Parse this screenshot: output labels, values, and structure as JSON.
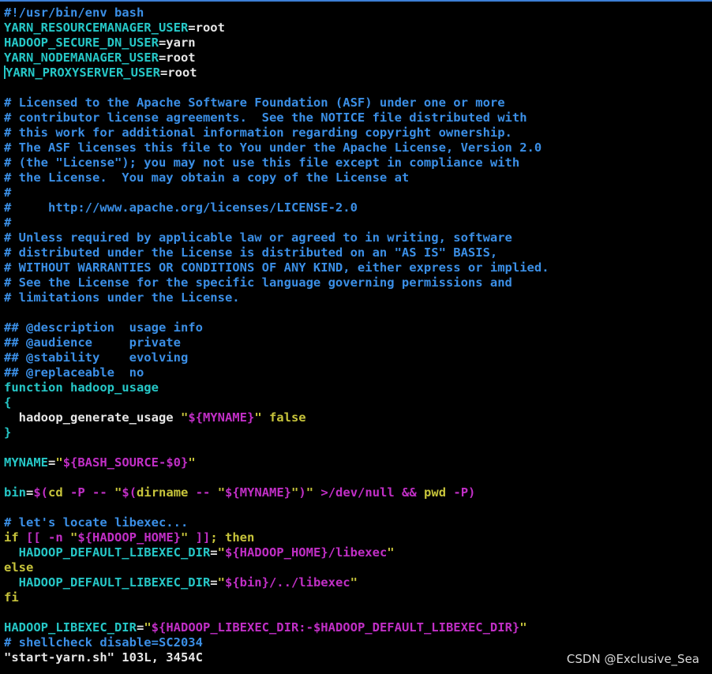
{
  "editor": {
    "file_name": "start-yarn.sh",
    "status_line": "\"start-yarn.sh\" 103L, 3454C",
    "lines": [
      [
        {
          "t": "#!/usr/bin/env bash",
          "c": "comment"
        }
      ],
      [
        {
          "t": "YARN_RESOURCEMANAGER_USER",
          "c": "cyan"
        },
        {
          "t": "=root",
          "c": "plain"
        }
      ],
      [
        {
          "t": "HADOOP_SECURE_DN_USER",
          "c": "cyan"
        },
        {
          "t": "=yarn",
          "c": "plain"
        }
      ],
      [
        {
          "t": "YARN_NODEMANAGER_USER",
          "c": "cyan"
        },
        {
          "t": "=root",
          "c": "plain"
        }
      ],
      [
        {
          "t": "",
          "c": "cursor"
        },
        {
          "t": "YARN_PROXYSERVER_USER",
          "c": "cyan"
        },
        {
          "t": "=root",
          "c": "plain"
        }
      ],
      [],
      [
        {
          "t": "# Licensed to the Apache Software Foundation (ASF) under one or more",
          "c": "comment"
        }
      ],
      [
        {
          "t": "# contributor license agreements.  See the NOTICE file distributed with",
          "c": "comment"
        }
      ],
      [
        {
          "t": "# this work for additional information regarding copyright ownership.",
          "c": "comment"
        }
      ],
      [
        {
          "t": "# The ASF licenses this file to You under the Apache License, Version 2.0",
          "c": "comment"
        }
      ],
      [
        {
          "t": "# (the \"License\"); you may not use this file except in compliance with",
          "c": "comment"
        }
      ],
      [
        {
          "t": "# the License.  You may obtain a copy of the License at",
          "c": "comment"
        }
      ],
      [
        {
          "t": "#",
          "c": "comment"
        }
      ],
      [
        {
          "t": "#     http://www.apache.org/licenses/LICENSE-2.0",
          "c": "comment"
        }
      ],
      [
        {
          "t": "#",
          "c": "comment"
        }
      ],
      [
        {
          "t": "# Unless required by applicable law or agreed to in writing, software",
          "c": "comment"
        }
      ],
      [
        {
          "t": "# distributed under the License is distributed on an \"AS IS\" BASIS,",
          "c": "comment"
        }
      ],
      [
        {
          "t": "# WITHOUT WARRANTIES OR CONDITIONS OF ANY KIND, either express or implied.",
          "c": "comment"
        }
      ],
      [
        {
          "t": "# See the License for the specific language governing permissions and",
          "c": "comment"
        }
      ],
      [
        {
          "t": "# limitations under the License.",
          "c": "comment"
        }
      ],
      [],
      [
        {
          "t": "## @description  usage info",
          "c": "comment"
        }
      ],
      [
        {
          "t": "## @audience     private",
          "c": "comment"
        }
      ],
      [
        {
          "t": "## @stability    evolving",
          "c": "comment"
        }
      ],
      [
        {
          "t": "## @replaceable  no",
          "c": "comment"
        }
      ],
      [
        {
          "t": "function hadoop_usage",
          "c": "cyan"
        }
      ],
      [
        {
          "t": "{",
          "c": "cyan"
        }
      ],
      [
        {
          "t": "  hadoop_generate_usage ",
          "c": "plain"
        },
        {
          "t": "\"",
          "c": "yellow"
        },
        {
          "t": "${MYNAME}",
          "c": "magenta"
        },
        {
          "t": "\" false",
          "c": "yellow"
        }
      ],
      [
        {
          "t": "}",
          "c": "cyan"
        }
      ],
      [],
      [
        {
          "t": "MYNAME",
          "c": "cyan"
        },
        {
          "t": "=",
          "c": "plain"
        },
        {
          "t": "\"",
          "c": "yellow"
        },
        {
          "t": "${BASH_SOURCE-$0}",
          "c": "magenta"
        },
        {
          "t": "\"",
          "c": "yellow"
        }
      ],
      [],
      [
        {
          "t": "bin",
          "c": "cyan"
        },
        {
          "t": "=",
          "c": "plain"
        },
        {
          "t": "$(",
          "c": "magenta"
        },
        {
          "t": "cd ",
          "c": "yellow"
        },
        {
          "t": "-P -- ",
          "c": "magenta"
        },
        {
          "t": "\"",
          "c": "yellow"
        },
        {
          "t": "$(",
          "c": "magenta"
        },
        {
          "t": "dirname ",
          "c": "yellow"
        },
        {
          "t": "-- ",
          "c": "magenta"
        },
        {
          "t": "\"",
          "c": "yellow"
        },
        {
          "t": "${MYNAME}",
          "c": "magenta"
        },
        {
          "t": "\"",
          "c": "yellow"
        },
        {
          "t": ")",
          "c": "magenta"
        },
        {
          "t": "\" ",
          "c": "yellow"
        },
        {
          "t": ">/dev/null && ",
          "c": "magenta"
        },
        {
          "t": "pwd ",
          "c": "yellow"
        },
        {
          "t": "-P)",
          "c": "magenta"
        }
      ],
      [],
      [
        {
          "t": "# let's locate libexec...",
          "c": "comment"
        }
      ],
      [
        {
          "t": "if ",
          "c": "yellow"
        },
        {
          "t": "[[ -n ",
          "c": "magenta"
        },
        {
          "t": "\"",
          "c": "yellow"
        },
        {
          "t": "${HADOOP_HOME}",
          "c": "magenta"
        },
        {
          "t": "\" ",
          "c": "yellow"
        },
        {
          "t": "]]",
          "c": "magenta"
        },
        {
          "t": "; then",
          "c": "yellow"
        }
      ],
      [
        {
          "t": "  HADOOP_DEFAULT_LIBEXEC_DIR",
          "c": "cyan"
        },
        {
          "t": "=",
          "c": "plain"
        },
        {
          "t": "\"",
          "c": "yellow"
        },
        {
          "t": "${HADOOP_HOME}/libexec",
          "c": "magenta"
        },
        {
          "t": "\"",
          "c": "yellow"
        }
      ],
      [
        {
          "t": "else",
          "c": "yellow"
        }
      ],
      [
        {
          "t": "  HADOOP_DEFAULT_LIBEXEC_DIR",
          "c": "cyan"
        },
        {
          "t": "=",
          "c": "plain"
        },
        {
          "t": "\"",
          "c": "yellow"
        },
        {
          "t": "${bin}/../libexec",
          "c": "magenta"
        },
        {
          "t": "\"",
          "c": "yellow"
        }
      ],
      [
        {
          "t": "fi",
          "c": "yellow"
        }
      ],
      [],
      [
        {
          "t": "HADOOP_LIBEXEC_DIR",
          "c": "cyan"
        },
        {
          "t": "=",
          "c": "plain"
        },
        {
          "t": "\"",
          "c": "yellow"
        },
        {
          "t": "${HADOOP_LIBEXEC_DIR:-$HADOOP_DEFAULT_LIBEXEC_DIR}",
          "c": "magenta"
        },
        {
          "t": "\"",
          "c": "yellow"
        }
      ],
      [
        {
          "t": "# shellcheck disable=SC2034",
          "c": "comment"
        }
      ]
    ]
  },
  "watermark": "CSDN @Exclusive_Sea"
}
